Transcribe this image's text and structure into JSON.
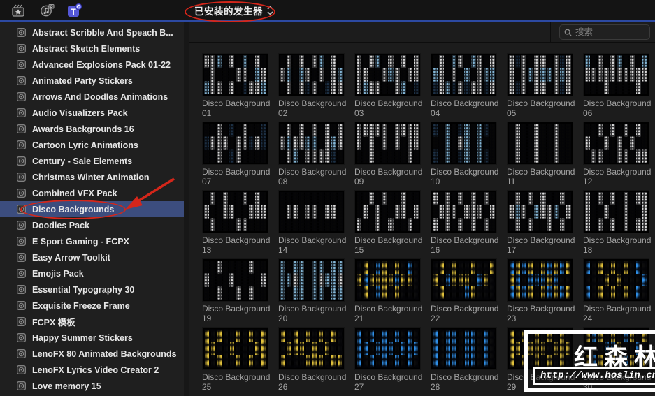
{
  "toolbar": {
    "dropdown_label": "已安装的发生器",
    "icons": [
      "effects-browser",
      "photos-audio-browser",
      "titles-generators-browser"
    ]
  },
  "search": {
    "placeholder": "搜索"
  },
  "sidebar": {
    "items": [
      {
        "label": "Abstract Scribble And Speach B...",
        "selected": false
      },
      {
        "label": "Abstract Sketch Elements",
        "selected": false
      },
      {
        "label": "Advanced Explosions Pack 01-22",
        "selected": false
      },
      {
        "label": "Animated Party Stickers",
        "selected": false
      },
      {
        "label": "Arrows And Doodles Animations",
        "selected": false
      },
      {
        "label": "Audio Visualizers Pack",
        "selected": false
      },
      {
        "label": "Awards Backgrounds 16",
        "selected": false
      },
      {
        "label": "Cartoon Lyric Animations",
        "selected": false
      },
      {
        "label": "Century - Sale Elements",
        "selected": false
      },
      {
        "label": "Christmas Winter Animation",
        "selected": false
      },
      {
        "label": "Combined VFX Pack",
        "selected": false
      },
      {
        "label": "Disco Backgrounds",
        "selected": true
      },
      {
        "label": "Doodles Pack",
        "selected": false
      },
      {
        "label": "E Sport Gaming - FCPX",
        "selected": false
      },
      {
        "label": "Easy Arrow Toolkit",
        "selected": false
      },
      {
        "label": "Emojis Pack",
        "selected": false
      },
      {
        "label": "Essential Typography 30",
        "selected": false
      },
      {
        "label": "Exquisite Freeze Frame",
        "selected": false
      },
      {
        "label": "FCPX 模板",
        "selected": false
      },
      {
        "label": "Happy Summer Stickers",
        "selected": false
      },
      {
        "label": "LenoFX 80 Animated Backgrounds",
        "selected": false
      },
      {
        "label": "LenoFX Lyrics Video Creator 2",
        "selected": false
      },
      {
        "label": "Love memory 15",
        "selected": false
      }
    ]
  },
  "grid": {
    "label_prefix": "Disco Background",
    "tiles": [
      {
        "num": "01",
        "style": "mosaic",
        "cols": [
          "WKB",
          "WWW",
          "BKW",
          "KKK",
          "WKW",
          "KWK",
          "BWN",
          "KKW",
          "WBW",
          "KWB"
        ]
      },
      {
        "num": "02",
        "style": "mosaic",
        "cols": [
          "KWK",
          "WBW",
          "KKK",
          "WBW",
          "KWN",
          "WKW",
          "BWK",
          "KKN",
          "WWW",
          "KBW"
        ]
      },
      {
        "num": "03",
        "style": "mosaic",
        "cols": [
          "WWW",
          "KWB",
          "WKW",
          "BKW",
          "KWK",
          "WBK",
          "KWW",
          "WKB",
          "KWK",
          "WWN"
        ]
      },
      {
        "num": "04",
        "style": "mosaic",
        "cols": [
          "KBN",
          "WWW",
          "KKB",
          "BWN",
          "WKW",
          "KBN",
          "BKW",
          "WWW",
          "KBN",
          "WBW"
        ]
      },
      {
        "num": "05",
        "style": "mosaic",
        "cols": [
          "WWW",
          "NKN",
          "WWW",
          "KBK",
          "WWW",
          "WBW",
          "KBK",
          "WWW",
          "NBN",
          "WWW"
        ]
      },
      {
        "num": "06",
        "style": "mosaic",
        "cols": [
          "BWK",
          "KWK",
          "WWK",
          "KWW",
          "WWK",
          "BWK",
          "KWK",
          "WWK",
          "KWW",
          "BWK"
        ]
      },
      {
        "num": "07",
        "style": "mosaic",
        "cols": [
          "KNK",
          "KWK",
          "WWW",
          "KWK",
          "NKN",
          "KWW",
          "WWK",
          "KNK",
          "KWK",
          "NNK"
        ]
      },
      {
        "num": "08",
        "style": "mosaic",
        "cols": [
          "KWK",
          "WBW",
          "KWB",
          "WWK",
          "KBW",
          "WBW",
          "KKW",
          "WWW",
          "KBN",
          "WWK"
        ]
      },
      {
        "num": "09",
        "style": "mosaic",
        "cols": [
          "WWK",
          "WKK",
          "WWW",
          "WKK",
          "WWK",
          "KKK",
          "WWK",
          "WKK",
          "WWW",
          "WWK"
        ]
      },
      {
        "num": "10",
        "style": "mosaic",
        "cols": [
          "NKN",
          "KKK",
          "BBB",
          "KKK",
          "NWN",
          "BBB",
          "KKK",
          "BBB",
          "NKN",
          "KKK"
        ]
      },
      {
        "num": "11",
        "style": "mosaic",
        "cols": [
          "KKK",
          "WWW",
          "KKK",
          "KKK",
          "WWW",
          "KKK",
          "KKK",
          "WWW",
          "KKK",
          "KKK"
        ]
      },
      {
        "num": "12",
        "style": "mosaic",
        "cols": [
          "KWK",
          "KKW",
          "WKW",
          "KWK",
          "WKK",
          "KWW",
          "WKW",
          "KWK",
          "WKW",
          "KKW"
        ]
      },
      {
        "num": "13",
        "style": "mosaic",
        "cols": [
          "KWK",
          "WKW",
          "KKK",
          "WWK",
          "KWK",
          "KKW",
          "WKW",
          "KWK",
          "WWK",
          "KWK"
        ]
      },
      {
        "num": "14",
        "style": "mosaic",
        "cols": [
          "KKK",
          "KWK",
          "KWK",
          "KKK",
          "KWK",
          "KWK",
          "KKK",
          "KWK",
          "KWK",
          "KKK"
        ]
      },
      {
        "num": "15",
        "style": "mosaic",
        "cols": [
          "KKW",
          "KWK",
          "WKK",
          "KWW",
          "WKK",
          "KKW",
          "KWK",
          "WWK",
          "KKW",
          "KWK"
        ]
      },
      {
        "num": "16",
        "style": "mosaic",
        "cols": [
          "WKW",
          "KWK",
          "WWW",
          "KWK",
          "WKW",
          "KWK",
          "WWW",
          "KWK",
          "WKW",
          "KWK"
        ]
      },
      {
        "num": "17",
        "style": "mosaic",
        "cols": [
          "KWK",
          "WBW",
          "KWK",
          "WKW",
          "KBK",
          "WWK",
          "KWW",
          "KBK",
          "WKW",
          "KWK"
        ]
      },
      {
        "num": "18",
        "style": "mosaic",
        "cols": [
          "WWW",
          "KKK",
          "WKW",
          "KWK",
          "WKW",
          "KKK",
          "WWW",
          "KKK",
          "WKW",
          "WWW"
        ]
      },
      {
        "num": "19",
        "style": "mosaic",
        "cols": [
          "KWK",
          "KKK",
          "WKW",
          "KKK",
          "KWK",
          "KKW",
          "KKK",
          "WKW",
          "KKK",
          "KWK"
        ]
      },
      {
        "num": "20",
        "style": "mosaic",
        "cols": [
          "BBB",
          "KBK",
          "BWB",
          "BBB",
          "KKK",
          "BBB",
          "BWB",
          "KBK",
          "BBB",
          "BWB"
        ]
      },
      {
        "num": "21",
        "style": "glow",
        "cols": [
          "DYD",
          "YCY",
          "DYD",
          "CYC",
          "YYY",
          "DYD",
          "YCY",
          "DYD",
          "CYD",
          "DDD"
        ]
      },
      {
        "num": "22",
        "style": "glow",
        "cols": [
          "DYD",
          "YDY",
          "DCD",
          "YYD",
          "DYD",
          "DYC",
          "YDY",
          "DCD",
          "DYD",
          "YDD"
        ]
      },
      {
        "num": "23",
        "style": "glow",
        "cols": [
          "CYC",
          "YCY",
          "CDC",
          "YCY",
          "DCD",
          "YCY",
          "CYC",
          "YCY",
          "CDC",
          "YDY"
        ]
      },
      {
        "num": "24",
        "style": "glow",
        "cols": [
          "CDC",
          "DDD",
          "YDY",
          "DYD",
          "YDY",
          "DYD",
          "YDY",
          "DDD",
          "CDC",
          "DCD"
        ]
      },
      {
        "num": "25",
        "style": "glow",
        "cols": [
          "YYY",
          "DYD",
          "YDY",
          "DDD",
          "DYD",
          "YDY",
          "DDD",
          "YDY",
          "DYD",
          "YYY"
        ]
      },
      {
        "num": "26",
        "style": "glow",
        "cols": [
          "YDY",
          "DYD",
          "YYD",
          "DYD",
          "YDY",
          "DYY",
          "YDY",
          "DYD",
          "YDY",
          "DDY"
        ]
      },
      {
        "num": "27",
        "style": "glow",
        "cols": [
          "CCC",
          "DCD",
          "CDC",
          "DCD",
          "CCC",
          "DCD",
          "CDC",
          "DCD",
          "CCC",
          "DCD"
        ]
      },
      {
        "num": "28",
        "style": "glow",
        "cols": [
          "CCC",
          "DDD",
          "CCC",
          "CCC",
          "DDD",
          "CCC",
          "CCC",
          "DDD",
          "CCC",
          "DDD"
        ]
      },
      {
        "num": "29",
        "style": "glow",
        "cols": [
          "YYY",
          "DYD",
          "YDY",
          "DYD",
          "YYY",
          "DYD",
          "YDY",
          "DYD",
          "YYY",
          "DYD"
        ]
      },
      {
        "num": "30",
        "style": "glow",
        "cols": [
          "YDY",
          "CDC",
          "YDY",
          "DCD",
          "YCY",
          "DYD",
          "CDC",
          "YDY",
          "DCD",
          "YDY"
        ]
      }
    ]
  },
  "watermark": {
    "title": "红森林",
    "url": "http://www.hoslin.cn/"
  },
  "colors": {
    "selection_blue": "#3c4d7e",
    "annotation_red": "#d4261a",
    "accent_line_blue": "#2c49a2",
    "palette": {
      "W": "#dedede",
      "B": "#85b8d8",
      "N": "#1d3146",
      "K": "#060606",
      "Y": "#e2c23c",
      "C": "#2f8fe8",
      "D": "#0c0c0c"
    }
  }
}
